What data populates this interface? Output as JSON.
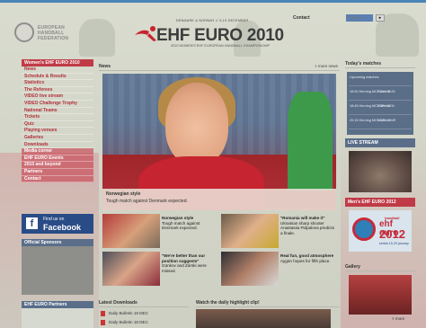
{
  "header": {
    "host_line": "DENMARK & NORWAY // 3-19 DECEMBER",
    "title": "EHF EURO 2010",
    "subtitle": "2010 WOMEN'S EHF EUROPEAN HANDBALL CHAMPIONSHIP",
    "federation": "EUROPEAN HANDBALL FEDERATION",
    "contact": "Contact",
    "search_placeholder": "search",
    "search_go": "▸"
  },
  "nav": {
    "heading": "Women's EHF EURO 2010",
    "items": [
      "News",
      "Schedule & Results",
      "Statistics",
      "The Referees",
      "VIDEO live stream",
      "VIDEO Challenge Trophy",
      "National Teams",
      "Tickets",
      "Quiz",
      "Playing venues",
      "Galleries",
      "Downloads"
    ],
    "secondary": [
      "Media corner",
      "EHF EURO Events",
      "2010 and beyond",
      "Partners",
      "Contact"
    ]
  },
  "facebook": {
    "line1": "Find us on",
    "line2": "Facebook"
  },
  "sponsors_heading": "Official Sponsors",
  "partners_heading": "EHF EURO Partners",
  "news": {
    "heading": "News",
    "more": "> more news",
    "hero_title": "Norwegian style",
    "hero_text": "Tough match against Denmark expected.",
    "tiles": [
      {
        "title": "Norwegian style",
        "text": "Tough match against Denmark expected."
      },
      {
        "title": "\"Romania will make it\"",
        "text": "Ukrainian sharp shooter Anastasiia Pidpalova predicts a finale."
      },
      {
        "title": "\"We're better than our position suggests\"",
        "text": "Günkov and Zárski were missed."
      },
      {
        "title": "Real fun, good atmosphere",
        "text": "Aygün hopes for fifth place."
      }
    ]
  },
  "downloads": {
    "heading": "Latest Downloads",
    "items": [
      "Daily Bulletin 19 DEC",
      "Daily Bulletin 18 DEC"
    ]
  },
  "highlight_heading": "Watch the daily highlight clip!",
  "today": {
    "heading": "Today's matches",
    "rows": [
      {
        "left": "Upcoming matches",
        "right": ""
      },
      {
        "left": "16:00  Herning MCH Arena",
        "right": "ROU / RUS"
      },
      {
        "left": "18:45  Herning MCH Arena",
        "right": "ESP / DEN"
      },
      {
        "left": "20:15  Herning MCH Arena",
        "right": "NOR / SWE"
      }
    ]
  },
  "live_heading": "LIVE STREAM",
  "mens": {
    "heading": "Men's EHF EURO 2012",
    "small": "handball",
    "euro": "ehf euro",
    "year": "2012",
    "where": "serbia 15-29 january"
  },
  "gallery": {
    "heading": "Gallery",
    "more": "> more"
  },
  "colors": {
    "accent_red": "#c03b47",
    "nav_text": "#b3303c",
    "panel_blue": "#5a6e8a",
    "facebook": "#2a4c86"
  }
}
